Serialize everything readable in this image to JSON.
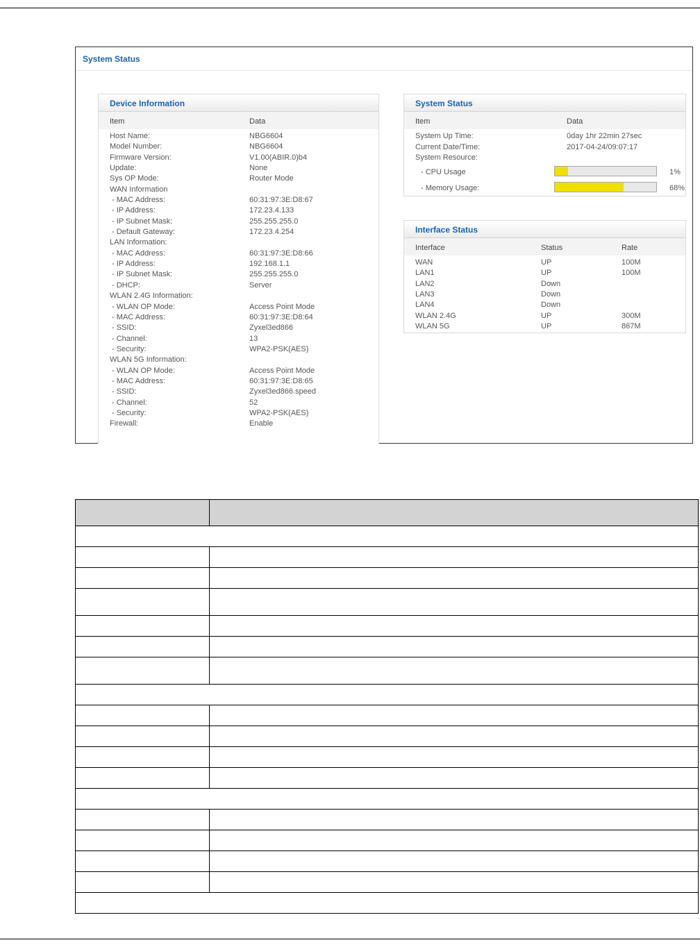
{
  "screenshot": {
    "title": "System Status",
    "device_info": {
      "heading": "Device Information",
      "col_item": "Item",
      "col_data": "Data",
      "rows": [
        {
          "item": "Host Name:",
          "data": "NBG6604",
          "indent": false
        },
        {
          "item": "Model Number:",
          "data": "NBG6604",
          "indent": false
        },
        {
          "item": "Firmware Version:",
          "data": "V1.00(ABIR.0)b4",
          "indent": false
        },
        {
          "item": "Update:",
          "data": "None",
          "indent": false
        },
        {
          "item": "Sys OP Mode:",
          "data": "Router Mode",
          "indent": false
        },
        {
          "item": "WAN Information",
          "data": "",
          "indent": false
        },
        {
          "item": "- MAC Address:",
          "data": "60:31:97:3E:D8:67",
          "indent": true
        },
        {
          "item": "- IP Address:",
          "data": "172.23.4.133",
          "indent": true
        },
        {
          "item": "- IP Subnet Mask:",
          "data": "255.255.255.0",
          "indent": true
        },
        {
          "item": "- Default Gateway:",
          "data": "172.23.4.254",
          "indent": true
        },
        {
          "item": "LAN Information:",
          "data": "",
          "indent": false
        },
        {
          "item": "- MAC Address:",
          "data": "60:31:97:3E:D8:66",
          "indent": true
        },
        {
          "item": "- IP Address:",
          "data": "192.168.1.1",
          "indent": true
        },
        {
          "item": "- IP Subnet Mask:",
          "data": "255.255.255.0",
          "indent": true
        },
        {
          "item": "- DHCP:",
          "data": "Server",
          "indent": true
        },
        {
          "item": "WLAN 2.4G Information:",
          "data": "",
          "indent": false
        },
        {
          "item": "- WLAN OP Mode:",
          "data": "Access Point Mode",
          "indent": true
        },
        {
          "item": "- MAC Address:",
          "data": "60:31:97:3E:D8:64",
          "indent": true
        },
        {
          "item": "- SSID:",
          "data": "Zyxel3ed866",
          "indent": true
        },
        {
          "item": "- Channel:",
          "data": "13",
          "indent": true
        },
        {
          "item": "- Security:",
          "data": "WPA2-PSK(AES)",
          "indent": true
        },
        {
          "item": "WLAN 5G Information:",
          "data": "",
          "indent": false
        },
        {
          "item": "- WLAN OP Mode:",
          "data": "Access Point Mode",
          "indent": true
        },
        {
          "item": "- MAC Address:",
          "data": "60:31:97:3E:D8:65",
          "indent": true
        },
        {
          "item": "- SSID:",
          "data": "Zyxel3ed866.speed",
          "indent": true
        },
        {
          "item": "- Channel:",
          "data": "52",
          "indent": true
        },
        {
          "item": "- Security:",
          "data": "WPA2-PSK(AES)",
          "indent": true
        },
        {
          "item": "Firewall:",
          "data": "Enable",
          "indent": false
        }
      ]
    },
    "system_status": {
      "heading": "System Status",
      "col_item": "Item",
      "col_data": "Data",
      "uptime_label": "System Up Time:",
      "uptime_value": "0day 1hr 22min 27sec",
      "datetime_label": "Current Date/Time:",
      "datetime_value": "2017-04-24/09:07:17",
      "resource_label": "System Resource:",
      "cpu_label": "- CPU Usage",
      "cpu_text": "1%",
      "cpu_level": 0.13,
      "mem_label": "- Memory Usage:",
      "mem_text": "68%",
      "mem_level": 0.68
    },
    "interface_status": {
      "heading": "Interface Status",
      "col_interface": "Interface",
      "col_status": "Status",
      "col_rate": "Rate",
      "rows": [
        {
          "interface": "WAN",
          "status": "UP",
          "rate": "100M"
        },
        {
          "interface": "LAN1",
          "status": "UP",
          "rate": "100M"
        },
        {
          "interface": "LAN2",
          "status": "Down",
          "rate": ""
        },
        {
          "interface": "LAN3",
          "status": "Down",
          "rate": ""
        },
        {
          "interface": "LAN4",
          "status": "Down",
          "rate": ""
        },
        {
          "interface": "WLAN 2.4G",
          "status": "UP",
          "rate": "300M"
        },
        {
          "interface": "WLAN 5G",
          "status": "UP",
          "rate": "867M"
        }
      ]
    }
  },
  "colors": {
    "heading_blue": "#1a63ae",
    "meter_yellow": "#f0e000",
    "table_header_gray": "#d3d3d3"
  }
}
